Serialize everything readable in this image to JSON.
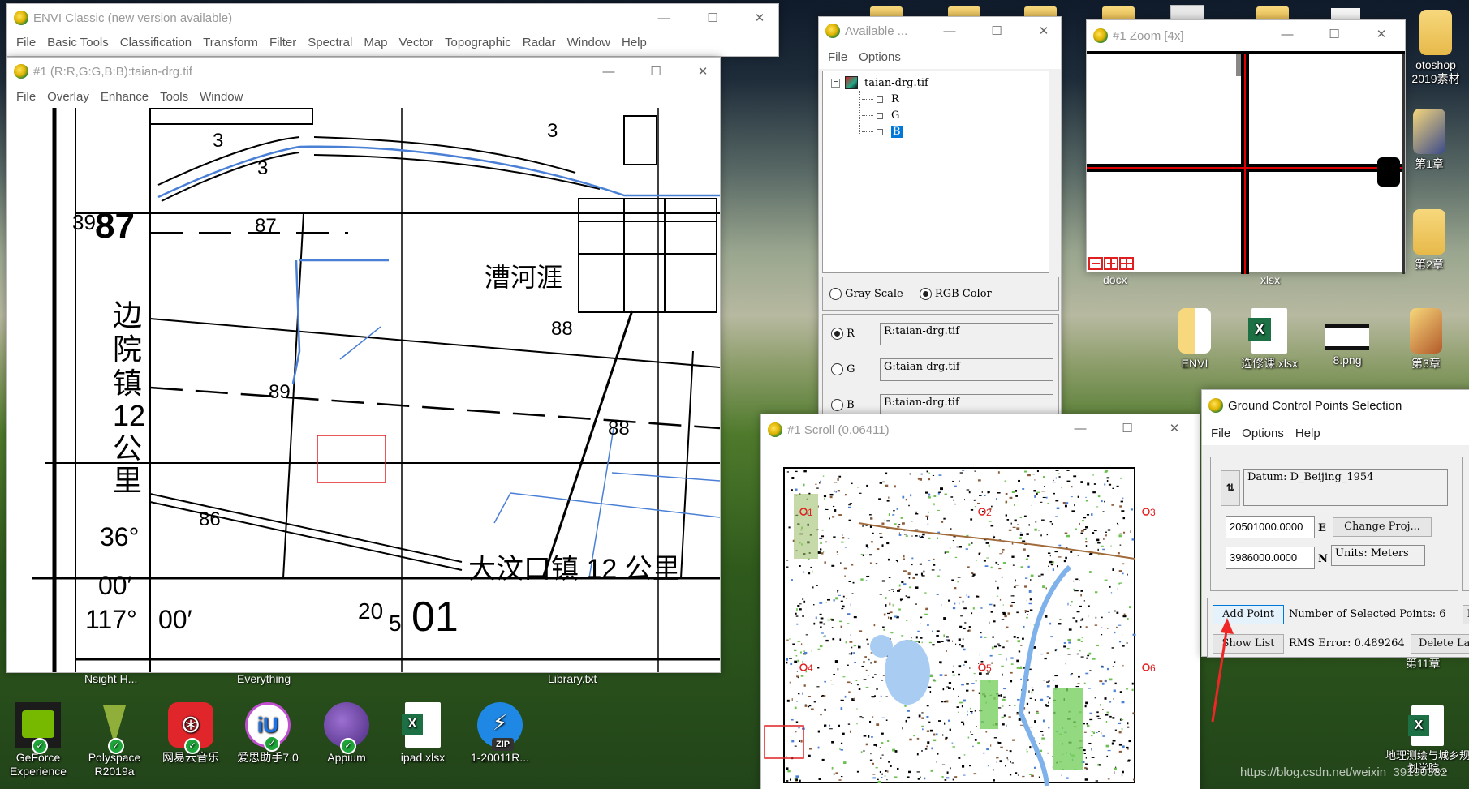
{
  "envi_main": {
    "title": "ENVI Classic (new version available)",
    "menu": [
      "File",
      "Basic Tools",
      "Classification",
      "Transform",
      "Filter",
      "Spectral",
      "Map",
      "Vector",
      "Topographic",
      "Radar",
      "Window",
      "Help"
    ]
  },
  "image_window": {
    "title": "#1 (R:R,G:G,B:B):taian-drg.tif",
    "menu": [
      "File",
      "Overlay",
      "Enhance",
      "Tools",
      "Window"
    ],
    "map_labels": {
      "northing_small": "39",
      "northing_big": "87",
      "elev_87": "87",
      "elev_89": "89",
      "elev_88a": "88",
      "elev_88b": "88",
      "elev_86": "86",
      "num_3a": "3",
      "num_3b": "3",
      "num_3c": "3",
      "place_caohe": "漕河涯",
      "left_vertical": [
        "边",
        "院",
        "镇",
        "12",
        "公",
        "里"
      ],
      "lat_deg": "36°",
      "lat_min": "00′",
      "lon_deg": "117°",
      "lon_min": "00′",
      "easting_small": "20",
      "easting_sub": "5",
      "easting_big": "01",
      "bottom_place": "大汶口镇 12 公里"
    }
  },
  "available_bands": {
    "title": "Available ...",
    "menu": [
      "File",
      "Options"
    ],
    "tree": {
      "file": "taian-drg.tif",
      "bands": [
        "R",
        "G",
        "B"
      ],
      "selected_band": "B"
    },
    "mode_options": [
      {
        "label": "Gray Scale",
        "selected": false
      },
      {
        "label": "RGB Color",
        "selected": true
      }
    ],
    "channels": [
      {
        "label": "R",
        "value": "R:taian-drg.tif",
        "selected": true
      },
      {
        "label": "G",
        "value": "G:taian-drg.tif",
        "selected": false
      },
      {
        "label": "B",
        "value": "B:taian-drg.tif",
        "selected": false
      }
    ]
  },
  "zoom_window": {
    "title": "#1 Zoom [4x]",
    "controls": [
      "zoom-out",
      "zoom-in",
      "toggle-grid"
    ]
  },
  "scroll_window": {
    "title": "#1 Scroll (0.06411)",
    "gcp_markers": [
      "1",
      "2",
      "3",
      "4",
      "5",
      "6"
    ]
  },
  "gcp_window": {
    "title": "Ground Control Points Selection",
    "menu": [
      "File",
      "Options",
      "Help"
    ],
    "datum": "Datum: D_Beijing_1954",
    "easting": "20501000.0000",
    "easting_unit": "E",
    "northing": "3986000.0000",
    "northing_unit": "N",
    "change_proj": "Change Proj...",
    "units": "Units: Meters",
    "add_point": "Add Point",
    "num_selected": "Number of Selected Points: 6",
    "show_list": "Show List",
    "rms_error": "RMS Error: 0.489264",
    "delete_last": "Delete Las",
    "partial_btn": "P"
  },
  "desktop": {
    "top_icons_right": [
      {
        "label": "otoshop\n2019素材"
      },
      {
        "label": "第1章"
      },
      {
        "label": "第2章"
      }
    ],
    "zoom_window_under_labels": [
      "docx",
      "xlsx"
    ],
    "row_icons": [
      "ENVI",
      "选修课.xlsx",
      "8.png",
      "第3章"
    ],
    "chapter_11": "第11章",
    "excel_bottom_right": "地理测绘与城乡规划学院...",
    "mid_labels": [
      "Nsight H...",
      "Everything",
      "Library.txt"
    ],
    "bottom_icons": [
      {
        "label": "GeForce Experience",
        "color": "#76b900"
      },
      {
        "label": "Polyspace R2019a",
        "color": "#8fae3a"
      },
      {
        "label": "网易云音乐",
        "color": "#e0262b"
      },
      {
        "label": "爱思助手7.0",
        "color": "#1a73e8"
      },
      {
        "label": "Appium",
        "color": "#6b3fa0"
      },
      {
        "label": "ipad.xlsx",
        "color": "#1d7044"
      },
      {
        "label": "1-20011R...",
        "color": "#1f88e5"
      }
    ],
    "watermark": "https://blog.csdn.net/weixin_39190382"
  }
}
